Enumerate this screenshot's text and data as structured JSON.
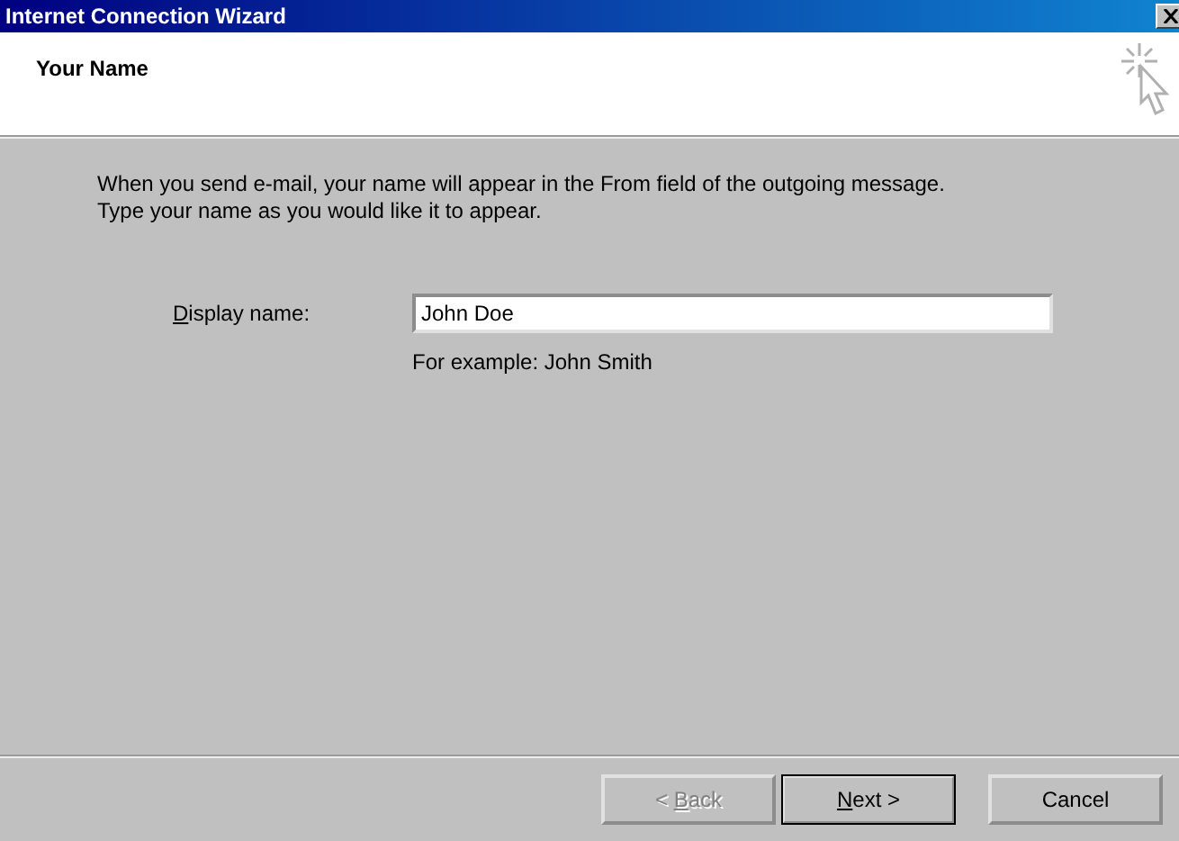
{
  "window": {
    "title": "Internet Connection Wizard"
  },
  "header": {
    "title": "Your Name"
  },
  "intro": [
    "When you send e-mail, your name will appear in the From field of the outgoing message.",
    "Type your name as you would like it to appear."
  ],
  "display_name": {
    "label_parts": {
      "key": "D",
      "post": "isplay name:"
    },
    "value": "John Doe",
    "hint": "For example: John Smith"
  },
  "buttons": [
    {
      "label_parts": {
        "pre": "< ",
        "key": "B",
        "post": "ack"
      },
      "disabled": true,
      "default": false
    },
    {
      "label_parts": {
        "key": "N",
        "post": "ext >"
      },
      "disabled": false,
      "default": true
    },
    {
      "label_parts": {
        "pre": "Cancel"
      },
      "disabled": false,
      "default": false
    }
  ]
}
